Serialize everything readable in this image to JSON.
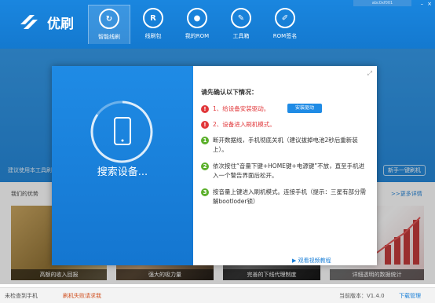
{
  "app": {
    "name": "优刷",
    "user": "abc0xf001"
  },
  "window_controls": [
    "–",
    "×"
  ],
  "nav": [
    {
      "label": "智能线刷",
      "icon": "smart-flash-icon",
      "glyph": "↻"
    },
    {
      "label": "线刷包",
      "icon": "rom-package-icon",
      "glyph": "R"
    },
    {
      "label": "我的ROM",
      "icon": "my-rom-icon",
      "glyph": "●"
    },
    {
      "label": "工具箱",
      "icon": "toolbox-icon",
      "glyph": "✎"
    },
    {
      "label": "ROM签名",
      "icon": "rom-sign-icon",
      "glyph": "✐"
    }
  ],
  "banner": {
    "text": "建议使用本工具刷",
    "oneclick": "新手一键刷机"
  },
  "advantages": {
    "title": "我们的优势",
    "more": ">>更多详情"
  },
  "thumbs": [
    {
      "caption": "高额的收入回报"
    },
    {
      "caption": "强大的吸力量"
    },
    {
      "caption": "完善的下线代理制度"
    },
    {
      "caption": "详细透明的数据统计"
    }
  ],
  "statusbar": {
    "device": "未检查到手机",
    "mode": "刷机失败请求我",
    "version": "当前版本：V1.4.0",
    "download": "下载管理"
  },
  "dialog": {
    "searching": "搜索设备...",
    "confirm_title": "请先确认以下情况：",
    "requirements": [
      {
        "num": "1",
        "text": "1、给设备安装驱动。",
        "button": "安装驱动"
      },
      {
        "num": "2",
        "text": "2、设备进入刷机模式。"
      }
    ],
    "steps": [
      {
        "num": "1",
        "text": "断开数据线，手机彻底关机（建议拔掉电池2秒后重新装上）。"
      },
      {
        "num": "2",
        "text": "依次按住“音量下键+HOME键+电源键”不放，直至手机进入一个警告界面后松开。"
      },
      {
        "num": "3",
        "text": "按音量上键进入刷机模式。连接手机（提示：三星有部分需解bootloder锁）"
      }
    ],
    "video_link": "观看视频教程"
  },
  "colors": {
    "brand": "#1a86df",
    "error": "#e1373a",
    "ok": "#5cb02c"
  }
}
